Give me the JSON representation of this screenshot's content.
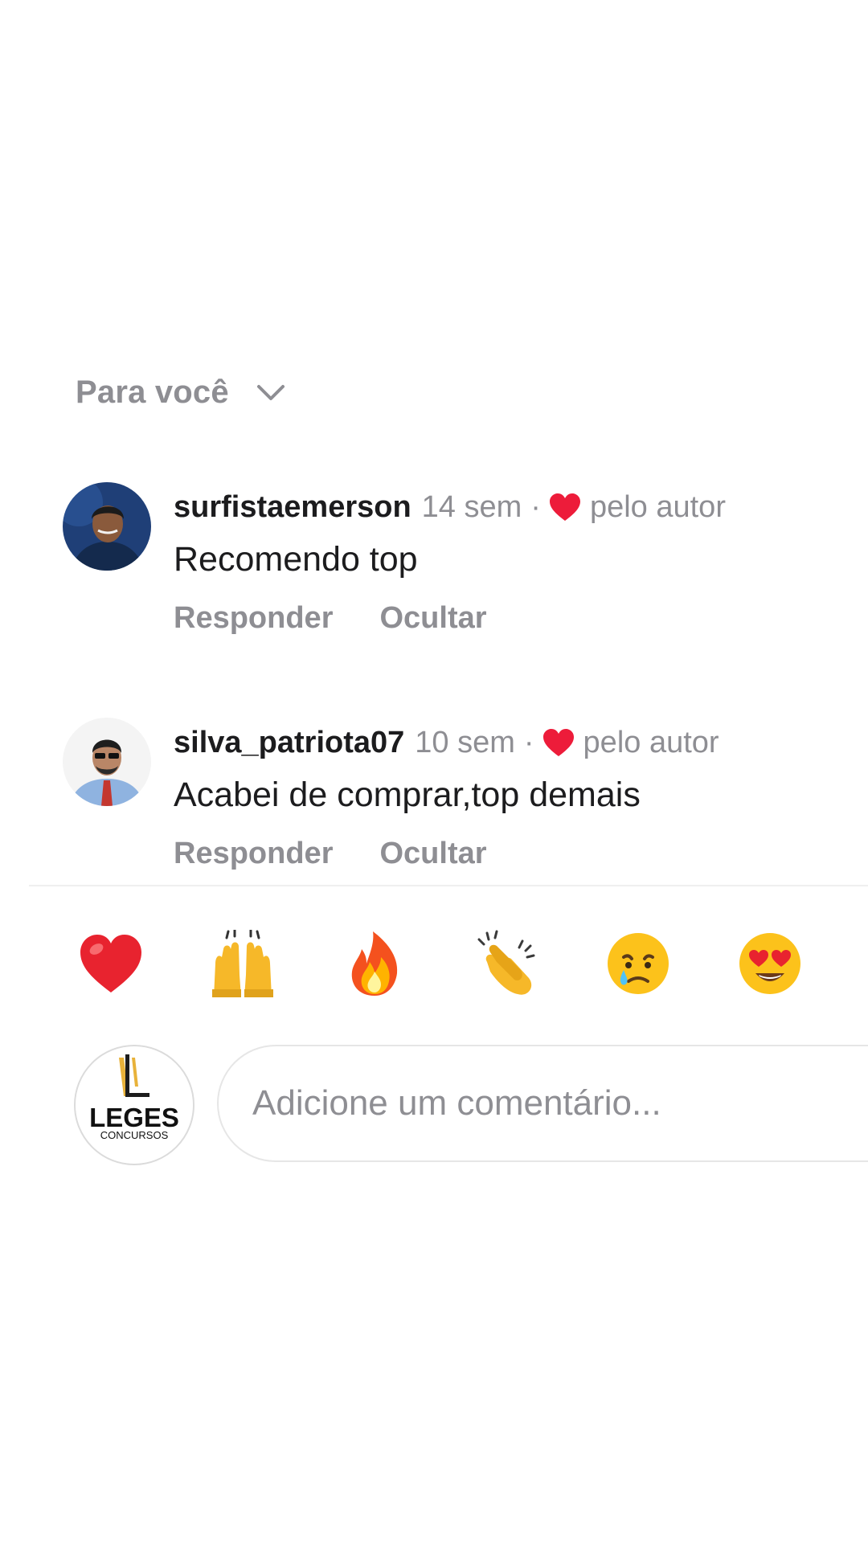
{
  "sort": {
    "label": "Para você",
    "icon": "chevron-down-icon"
  },
  "comments": [
    {
      "username": "surfistaemerson",
      "time": "14 sem",
      "separator": "·",
      "liked_by_author_label": "pelo autor",
      "text": "Recomendo top",
      "reply_label": "Responder",
      "hide_label": "Ocultar"
    },
    {
      "username": "silva_patriota07",
      "time": "10 sem",
      "separator": "·",
      "liked_by_author_label": "pelo autor",
      "text": "Acabei de comprar,top demais",
      "reply_label": "Responder",
      "hide_label": "Ocultar"
    }
  ],
  "reactions": [
    "red-heart-emoji",
    "raising-hands-emoji",
    "fire-emoji",
    "clapping-hands-emoji",
    "crying-face-emoji",
    "heart-eyes-emoji"
  ],
  "composer": {
    "avatar_brand": "LEGES",
    "avatar_subtitle": "CONCURSOS",
    "placeholder": "Adicione um comentário..."
  },
  "colors": {
    "heart": "#ed1c3a",
    "secondary_text": "#8e8e93",
    "primary_text": "#1c1c1e",
    "brand_gold": "#e8b23a"
  }
}
